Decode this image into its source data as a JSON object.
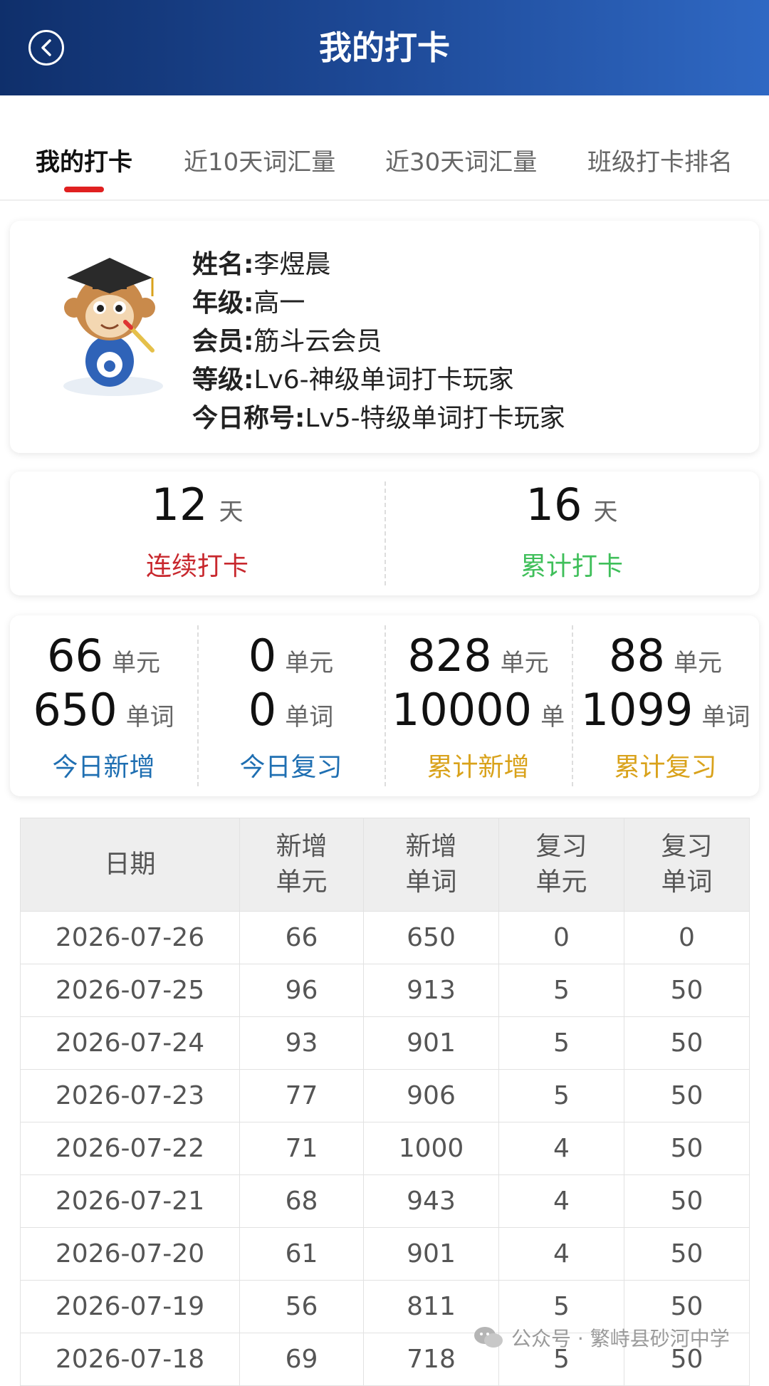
{
  "header": {
    "title": "我的打卡",
    "back_icon": "chevron-left-icon"
  },
  "tabs": [
    {
      "label": "我的打卡",
      "active": true
    },
    {
      "label": "近10天词汇量",
      "active": false
    },
    {
      "label": "近30天词汇量",
      "active": false
    },
    {
      "label": "班级打卡排名",
      "active": false
    }
  ],
  "profile": {
    "name_label": "姓名:",
    "name": "李煜晨",
    "grade_label": "年级:",
    "grade": "高一",
    "member_label": "会员:",
    "member": "筋斗云会员",
    "level_label": "等级:",
    "level": "Lv6-神级单词打卡玩家",
    "title_label": "今日称号:",
    "title": "Lv5-特级单词打卡玩家"
  },
  "checkin": {
    "streak": {
      "value": "12",
      "unit": "天",
      "label": "连续打卡",
      "color": "#c8282e"
    },
    "total": {
      "value": "16",
      "unit": "天",
      "label": "累计打卡",
      "color": "#3fbf5a"
    }
  },
  "stats": [
    {
      "units": "66",
      "units_unit": "单元",
      "words": "650",
      "words_unit": "单词",
      "label": "今日新增",
      "color": "#1f6fb2"
    },
    {
      "units": "0",
      "units_unit": "单元",
      "words": "0",
      "words_unit": "单词",
      "label": "今日复习",
      "color": "#1f6fb2"
    },
    {
      "units": "828",
      "units_unit": "单元",
      "words": "10000",
      "words_unit": "单",
      "label": "累计新增",
      "color": "#d9a21b"
    },
    {
      "units": "88",
      "units_unit": "单元",
      "words": "1099",
      "words_unit": "单词",
      "label": "累计复习",
      "color": "#d9a21b"
    }
  ],
  "table": {
    "headers": [
      "日期",
      "新增\n单元",
      "新增\n单词",
      "复习\n单元",
      "复习\n单词"
    ],
    "rows": [
      [
        "2026-07-26",
        "66",
        "650",
        "0",
        "0"
      ],
      [
        "2026-07-25",
        "96",
        "913",
        "5",
        "50"
      ],
      [
        "2026-07-24",
        "93",
        "901",
        "5",
        "50"
      ],
      [
        "2026-07-23",
        "77",
        "906",
        "5",
        "50"
      ],
      [
        "2026-07-22",
        "71",
        "1000",
        "4",
        "50"
      ],
      [
        "2026-07-21",
        "68",
        "943",
        "4",
        "50"
      ],
      [
        "2026-07-20",
        "61",
        "901",
        "4",
        "50"
      ],
      [
        "2026-07-19",
        "56",
        "811",
        "5",
        "50"
      ],
      [
        "2026-07-18",
        "69",
        "718",
        "5",
        "50"
      ]
    ]
  },
  "watermark": {
    "text": "公众号 · 繁峙县砂河中学",
    "icon": "wechat-icon"
  }
}
